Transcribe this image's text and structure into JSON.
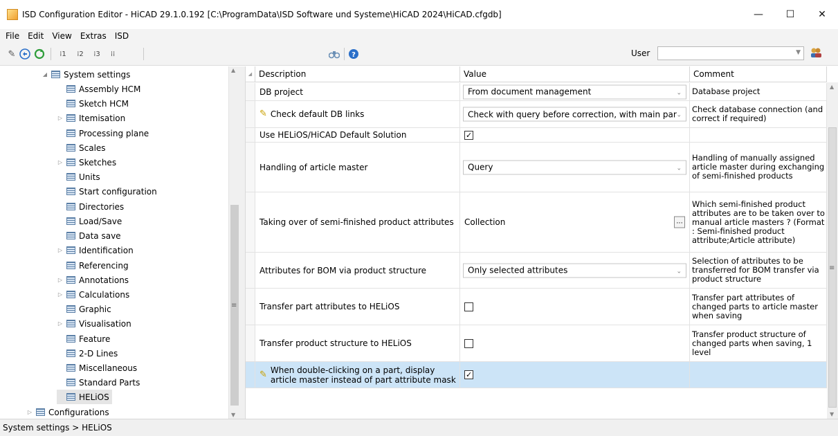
{
  "window": {
    "title": "ISD Configuration Editor  - HiCAD 29.1.0.192 [C:\\ProgramData\\ISD Software und Systeme\\HiCAD 2024\\HiCAD.cfgdb]",
    "minimize": "—",
    "maximize": "☐",
    "close": "✕"
  },
  "menu": [
    "File",
    "Edit",
    "View",
    "Extras",
    "ISD"
  ],
  "toolbar": {
    "user_label": "User",
    "user_value": "",
    "icons": [
      "pencil-icon",
      "undo-icon",
      "refresh-icon",
      "level-1-icon",
      "level-2-icon",
      "level-3-icon",
      "level-all-icon",
      "binoculars-icon",
      "help-icon",
      "users-icon"
    ]
  },
  "tree": {
    "nodes": [
      {
        "label": "System settings",
        "expander": "◢",
        "level": 0
      },
      {
        "label": "Assembly HCM",
        "expander": "",
        "level": 1
      },
      {
        "label": "Sketch HCM",
        "expander": "",
        "level": 1
      },
      {
        "label": "Itemisation",
        "expander": "▷",
        "level": 1
      },
      {
        "label": "Processing plane",
        "expander": "",
        "level": 1
      },
      {
        "label": "Scales",
        "expander": "",
        "level": 1
      },
      {
        "label": "Sketches",
        "expander": "▷",
        "level": 1
      },
      {
        "label": "Units",
        "expander": "",
        "level": 1
      },
      {
        "label": "Start configuration",
        "expander": "",
        "level": 1
      },
      {
        "label": "Directories",
        "expander": "",
        "level": 1
      },
      {
        "label": "Load/Save",
        "expander": "",
        "level": 1
      },
      {
        "label": "Data save",
        "expander": "",
        "level": 1
      },
      {
        "label": "Identification",
        "expander": "▷",
        "level": 1
      },
      {
        "label": "Referencing",
        "expander": "",
        "level": 1
      },
      {
        "label": "Annotations",
        "expander": "▷",
        "level": 1
      },
      {
        "label": "Calculations",
        "expander": "▷",
        "level": 1
      },
      {
        "label": "Graphic",
        "expander": "",
        "level": 1
      },
      {
        "label": "Visualisation",
        "expander": "▷",
        "level": 1
      },
      {
        "label": "Feature",
        "expander": "",
        "level": 1
      },
      {
        "label": "2-D Lines",
        "expander": "",
        "level": 1
      },
      {
        "label": "Miscellaneous",
        "expander": "",
        "level": 1
      },
      {
        "label": "Standard Parts",
        "expander": "",
        "level": 1
      },
      {
        "label": "HELiOS",
        "expander": "",
        "level": 1,
        "selected": true
      },
      {
        "label": "Configurations",
        "expander": "▷",
        "level": -1
      }
    ]
  },
  "grid": {
    "columns": [
      "Description",
      "Value",
      "Comment"
    ],
    "rows": [
      {
        "description": "DB project",
        "value_type": "combo",
        "value": "From document management",
        "comment": "Database project",
        "edited": false
      },
      {
        "description": "Check default DB links",
        "value_type": "combo",
        "value": "Check with query before correction, with main par",
        "comment": "Check database connection (and correct if required)",
        "edited": true
      },
      {
        "description": "Use HELiOS/HiCAD Default Solution",
        "value_type": "checkbox",
        "checked": true,
        "comment": "",
        "edited": false
      },
      {
        "description": "Handling of article master",
        "value_type": "combo",
        "value": "Query",
        "comment": "Handling of manually assigned article master during exchanging of semi-finished products",
        "edited": false
      },
      {
        "description": "Taking over of semi-finished product attributes",
        "value_type": "collection",
        "value": "Collection",
        "button": "...",
        "comment": "Which semi-finished product attributes are to be taken over to manual article masters ? (Format : Semi-finished product attribute;Article attribute)",
        "edited": false
      },
      {
        "description": "Attributes for BOM via product structure",
        "value_type": "combo",
        "value": "Only selected attributes",
        "comment": "Selection of attributes to be transferred for BOM transfer via product structure",
        "edited": false
      },
      {
        "description": "Transfer part attributes to HELiOS",
        "value_type": "checkbox",
        "checked": false,
        "comment": "Transfer part attributes of changed parts to article master when saving",
        "edited": false
      },
      {
        "description": "Transfer product structure to HELiOS",
        "value_type": "checkbox",
        "checked": false,
        "comment": "Transfer product structure of changed parts when saving, 1 level",
        "edited": false
      },
      {
        "description": "When double-clicking on a part, display article master instead of part attribute mask",
        "value_type": "checkbox",
        "checked": true,
        "comment": "",
        "edited": true,
        "highlighted": true
      }
    ]
  },
  "status": {
    "path": "System settings > HELiOS"
  },
  "colors": {
    "selection": "#cce4f7",
    "window_bg": "#f3f3f3"
  }
}
